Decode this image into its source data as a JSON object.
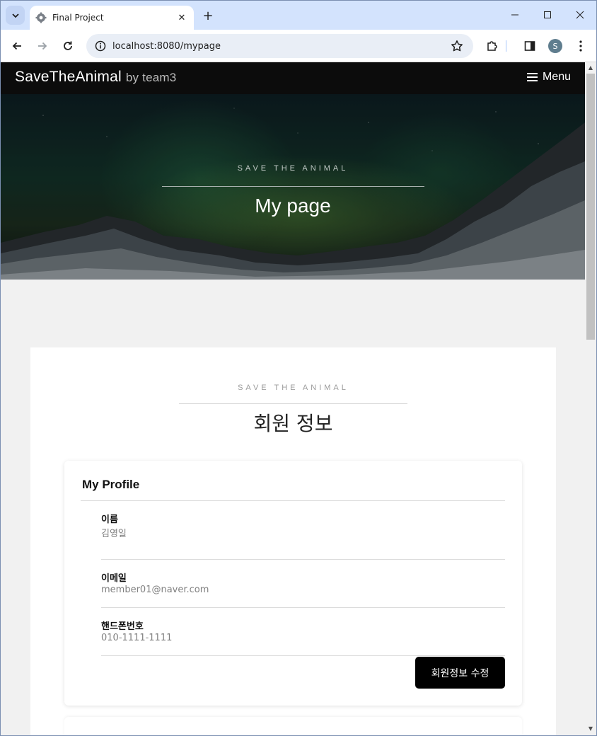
{
  "browser": {
    "tab_title": "Final Project",
    "url": "localhost:8080/mypage",
    "profile_initial": "S"
  },
  "site": {
    "brand": "SaveTheAnimal",
    "brand_sub": "by team3",
    "menu_label": "Menu"
  },
  "hero": {
    "eyebrow": "SAVE THE ANIMAL",
    "title": "My page"
  },
  "section": {
    "eyebrow": "SAVE THE ANIMAL",
    "title": "회원 정보"
  },
  "profile": {
    "title": "My Profile",
    "fields": [
      {
        "label": "이름",
        "value": "김영일"
      },
      {
        "label": "이메일",
        "value": "member01@naver.com"
      },
      {
        "label": "핸드폰번호",
        "value": "010-1111-1111"
      }
    ],
    "edit_button": "회원정보 수정"
  },
  "icons": {
    "tab_list": "chevron-down-icon",
    "favicon": "gear-icon",
    "tab_close": "close-icon",
    "new_tab": "plus-icon",
    "back": "arrow-left-icon",
    "forward": "arrow-right-icon",
    "reload": "reload-icon",
    "site_info": "info-icon",
    "bookmark": "star-icon",
    "extensions": "puzzle-icon",
    "side_panel": "side-panel-icon",
    "more": "kebab-menu-icon",
    "menu": "hamburger-icon"
  },
  "colors": {
    "nav_bg": "#0c0c0c",
    "button_bg": "#000000",
    "page_bg": "#f1f1f1",
    "tabbar_bg": "#d3e3fd"
  }
}
